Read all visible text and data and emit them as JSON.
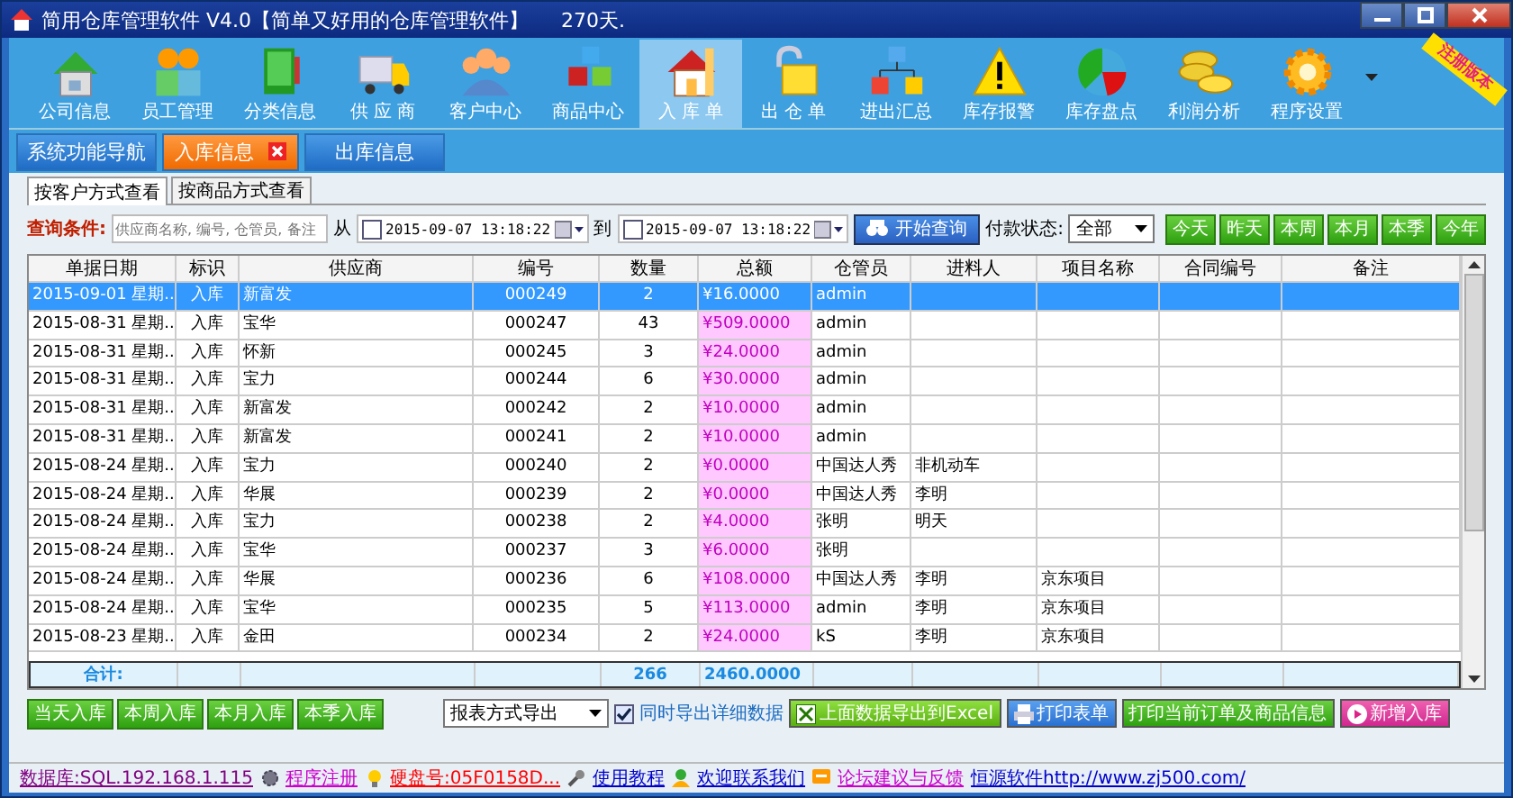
{
  "window": {
    "title": "简用仓库管理软件  V4.0【简单又好用的仓库管理软件】",
    "days": "270天."
  },
  "toolbar": {
    "items": [
      {
        "label": "公司信息",
        "selected": false
      },
      {
        "label": "员工管理",
        "selected": false
      },
      {
        "label": "分类信息",
        "selected": false
      },
      {
        "label": "供 应 商",
        "selected": false
      },
      {
        "label": "客户中心",
        "selected": false
      },
      {
        "label": "商品中心",
        "selected": false
      },
      {
        "label": "入 库 单",
        "selected": true
      },
      {
        "label": "出 仓 单",
        "selected": false
      },
      {
        "label": "进出汇总",
        "selected": false
      },
      {
        "label": "库存报警",
        "selected": false
      },
      {
        "label": "库存盘点",
        "selected": false
      },
      {
        "label": "利润分析",
        "selected": false
      },
      {
        "label": "程序设置",
        "selected": false
      }
    ],
    "ribbon": "注册版本"
  },
  "tabs": [
    {
      "label": "系统功能导航",
      "selected": false,
      "closable": false
    },
    {
      "label": "入库信息",
      "selected": true,
      "closable": true
    },
    {
      "label": "出库信息",
      "selected": false,
      "closable": false
    }
  ],
  "view_tabs": [
    {
      "label": "按客户方式查看",
      "selected": true
    },
    {
      "label": "按商品方式查看",
      "selected": false
    }
  ],
  "query": {
    "label": "查询条件:",
    "placeholder": "供应商名称, 编号, 仓管员, 备注",
    "from_label": "从",
    "from": {
      "value": "2015-09-07 13:18:22",
      "checked": false
    },
    "to_label": "到",
    "to": {
      "value": "2015-09-07 13:18:22",
      "checked": false
    },
    "search_button": "开始查询",
    "payment_label": "付款状态:",
    "payment_value": "全部",
    "period_buttons": [
      "今天",
      "昨天",
      "本周",
      "本月",
      "本季",
      "今年"
    ]
  },
  "table": {
    "columns": [
      "单据日期",
      "标识",
      "供应商",
      "编号",
      "数量",
      "总额",
      "仓管员",
      "进料人",
      "项目名称",
      "合同编号",
      "备注"
    ],
    "rows": [
      {
        "selected": true,
        "cells": [
          "2015-09-01 星期...",
          "入库",
          "新富发",
          "000249",
          "2",
          "¥16.0000",
          "admin",
          "",
          "",
          "",
          ""
        ]
      },
      {
        "selected": false,
        "cells": [
          "2015-08-31 星期...",
          "入库",
          "宝华",
          "000247",
          "43",
          "¥509.0000",
          "admin",
          "",
          "",
          "",
          ""
        ]
      },
      {
        "selected": false,
        "cells": [
          "2015-08-31 星期...",
          "入库",
          "怀新",
          "000245",
          "3",
          "¥24.0000",
          "admin",
          "",
          "",
          "",
          ""
        ]
      },
      {
        "selected": false,
        "cells": [
          "2015-08-31 星期...",
          "入库",
          "宝力",
          "000244",
          "6",
          "¥30.0000",
          "admin",
          "",
          "",
          "",
          ""
        ]
      },
      {
        "selected": false,
        "cells": [
          "2015-08-31 星期...",
          "入库",
          "新富发",
          "000242",
          "2",
          "¥10.0000",
          "admin",
          "",
          "",
          "",
          ""
        ]
      },
      {
        "selected": false,
        "cells": [
          "2015-08-31 星期...",
          "入库",
          "新富发",
          "000241",
          "2",
          "¥10.0000",
          "admin",
          "",
          "",
          "",
          ""
        ]
      },
      {
        "selected": false,
        "cells": [
          "2015-08-24 星期...",
          "入库",
          "宝力",
          "000240",
          "2",
          "¥0.0000",
          "中国达人秀",
          "非机动车",
          "",
          "",
          ""
        ]
      },
      {
        "selected": false,
        "cells": [
          "2015-08-24 星期...",
          "入库",
          "华展",
          "000239",
          "2",
          "¥0.0000",
          "中国达人秀",
          "李明",
          "",
          "",
          ""
        ]
      },
      {
        "selected": false,
        "cells": [
          "2015-08-24 星期...",
          "入库",
          "宝力",
          "000238",
          "2",
          "¥4.0000",
          "张明",
          "明天",
          "",
          "",
          ""
        ]
      },
      {
        "selected": false,
        "cells": [
          "2015-08-24 星期...",
          "入库",
          "宝华",
          "000237",
          "3",
          "¥6.0000",
          "张明",
          "",
          "",
          "",
          ""
        ]
      },
      {
        "selected": false,
        "cells": [
          "2015-08-24 星期...",
          "入库",
          "华展",
          "000236",
          "6",
          "¥108.0000",
          "中国达人秀",
          "李明",
          "京东项目",
          "",
          ""
        ]
      },
      {
        "selected": false,
        "cells": [
          "2015-08-24 星期...",
          "入库",
          "宝华",
          "000235",
          "5",
          "¥113.0000",
          "admin",
          "李明",
          "京东项目",
          "",
          ""
        ]
      },
      {
        "selected": false,
        "cells": [
          "2015-08-23 星期...",
          "入库",
          "金田",
          "000234",
          "2",
          "¥24.0000",
          "kS",
          "李明",
          "京东项目",
          "",
          ""
        ]
      }
    ],
    "totals": {
      "label": "合计:",
      "quantity": "266",
      "total": "2460.0000"
    }
  },
  "bottom": {
    "quick_buttons": [
      "当天入库",
      "本周入库",
      "本月入库",
      "本季入库"
    ],
    "export_select": "报表方式导出",
    "export_details": {
      "label": "同时导出详细数据",
      "checked": true
    },
    "actions": [
      {
        "label": "上面数据导出到Excel",
        "kind": "excel"
      },
      {
        "label": "打印表单",
        "kind": "print"
      },
      {
        "label": "打印当前订单及商品信息",
        "kind": "plain"
      },
      {
        "label": "新增入库",
        "kind": "add"
      }
    ]
  },
  "status_bar": {
    "links": [
      {
        "text": "数据库:SQL.192.168.1.115",
        "color": "#800080"
      },
      {
        "text": "程序注册",
        "color": "#cc00cc"
      },
      {
        "text": "硬盘号:05F0158D...",
        "color": "#ff0000"
      },
      {
        "text": "使用教程",
        "color": "#0000cc"
      },
      {
        "text": "欢迎联系我们",
        "color": "#0000cc"
      },
      {
        "text": "论坛建议与反馈",
        "color": "#cc00cc"
      },
      {
        "text": "恒源软件http://www.zj500.com/",
        "color": "#0000cc"
      }
    ]
  }
}
